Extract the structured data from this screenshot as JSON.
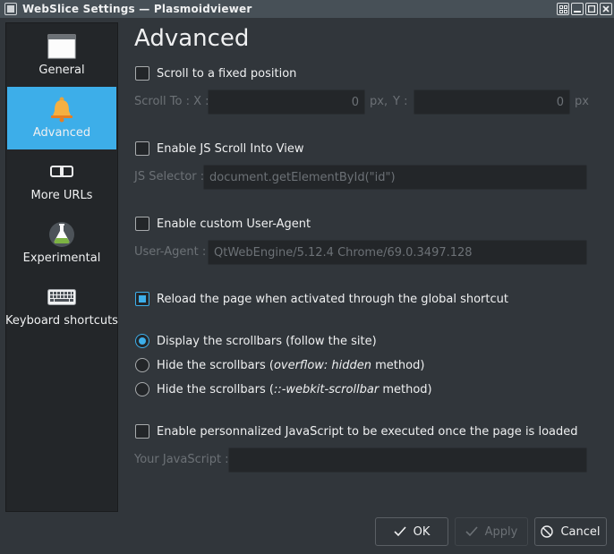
{
  "window": {
    "title": "WebSlice Settings — Plasmoidviewer"
  },
  "sidebar": {
    "items": [
      {
        "label": "General",
        "icon": "window-icon",
        "active": false
      },
      {
        "label": "Advanced",
        "icon": "bell-icon",
        "active": true
      },
      {
        "label": "More URLs",
        "icon": "link-icon",
        "active": false
      },
      {
        "label": "Experimental",
        "icon": "flask-icon",
        "active": false
      },
      {
        "label": "Keyboard shortcuts",
        "icon": "keyboard-icon",
        "active": false
      }
    ]
  },
  "main": {
    "title": "Advanced",
    "scroll_fixed": {
      "label": "Scroll to a fixed position",
      "checked": false
    },
    "scroll_to": {
      "label": "Scroll To : X :",
      "x_value": "0",
      "x_unit": "px,",
      "y_label": "Y :",
      "y_value": "0",
      "y_unit": "px"
    },
    "js_scroll": {
      "label": "Enable JS Scroll Into View",
      "checked": false
    },
    "js_selector": {
      "label": "JS Selector :",
      "value": "document.getElementById(\"id\")"
    },
    "custom_ua": {
      "label": "Enable custom User-Agent",
      "checked": false
    },
    "user_agent": {
      "label": "User-Agent :",
      "value": "QtWebEngine/5.12.4 Chrome/69.0.3497.128"
    },
    "reload": {
      "label": "Reload the page when activated through the global shortcut",
      "checked": true
    },
    "scrollbars": {
      "options": [
        {
          "pre": "Display the scrollbars (follow the site)",
          "em": "",
          "post": "",
          "checked": true
        },
        {
          "pre": "Hide the scrollbars (",
          "em": "overflow: hidden",
          "post": " method)",
          "checked": false
        },
        {
          "pre": "Hide the scrollbars (",
          "em": "::-webkit-scrollbar",
          "post": " method)",
          "checked": false
        }
      ]
    },
    "custom_js": {
      "label": "Enable personnalized JavaScript to be executed once the page is loaded",
      "checked": false
    },
    "your_js": {
      "label": "Your JavaScript :",
      "value": ""
    }
  },
  "buttons": {
    "ok": "OK",
    "apply": "Apply",
    "cancel": "Cancel"
  },
  "colors": {
    "accent": "#3daee9",
    "background": "#31363b",
    "field": "#232629"
  }
}
